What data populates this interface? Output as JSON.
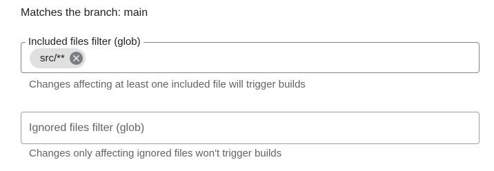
{
  "branch": {
    "text": "Matches the branch: main"
  },
  "included_filter": {
    "label": "Included files filter (glob)",
    "chips": [
      "src/**"
    ],
    "hint": "Changes affecting at least one included file will trigger builds"
  },
  "ignored_filter": {
    "label": "",
    "placeholder": "Ignored files filter (glob)",
    "hint": "Changes only affecting ignored files won't trigger builds"
  },
  "icons": {
    "chip_remove": "cancel-circle-icon"
  },
  "colors": {
    "chip_background": "#e0e0e0",
    "chip_remove_background": "#7a7d81",
    "hint_text": "#5f6368",
    "border": "#80868b"
  }
}
